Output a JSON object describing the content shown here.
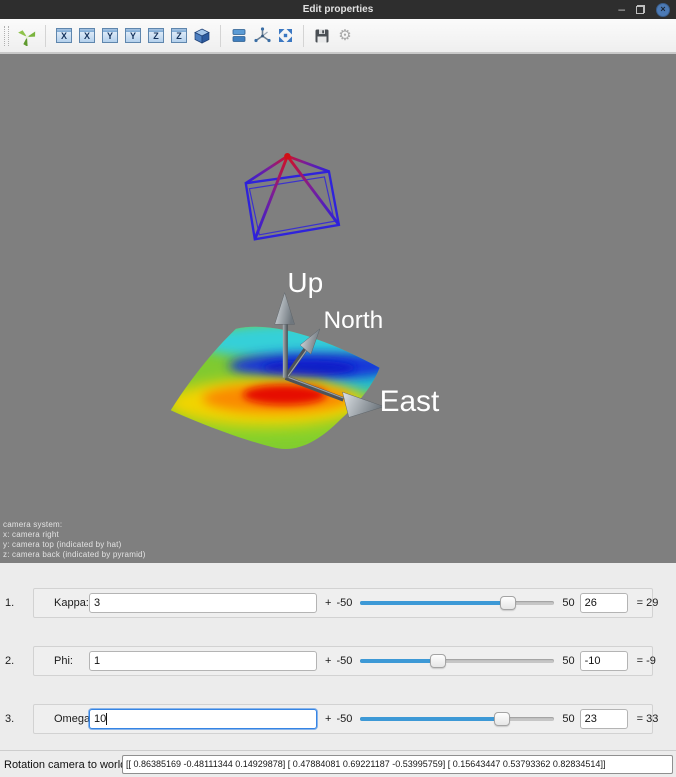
{
  "window": {
    "title": "Edit properties",
    "minimize_glyph": "–",
    "close_glyph": "×"
  },
  "toolbar": {
    "view_buttons": [
      {
        "label": "X"
      },
      {
        "label": "X"
      },
      {
        "label": "Y"
      },
      {
        "label": "Y"
      },
      {
        "label": "Z"
      },
      {
        "label": "Z"
      }
    ],
    "gear_glyph": "⚙",
    "icon_names": [
      "axes-triad-icon",
      "view-x-icon",
      "view-x2-icon",
      "view-y-icon",
      "view-y2-icon",
      "view-z-icon",
      "view-z2-icon",
      "cube-icon",
      "layers-icon",
      "origin-axes-icon",
      "fit-view-icon",
      "save-icon",
      "gear-icon"
    ]
  },
  "viewport": {
    "axis_labels": {
      "up": "Up",
      "north": "North",
      "east": "East"
    },
    "camera_info": [
      "camera system:",
      "x: camera right",
      "y: camera top (indicated by hat)",
      "z: camera back (indicated by pyramid)"
    ]
  },
  "controls": {
    "rows": [
      {
        "index": "1.",
        "label": "Kappa:",
        "offset_value": "3",
        "plus_sign": "+",
        "range_min": "-50",
        "range_max": "50",
        "slider_percent": 76,
        "slider_value": "26",
        "result": "= 29"
      },
      {
        "index": "2.",
        "label": "Phi:",
        "offset_value": "1",
        "plus_sign": "+",
        "range_min": "-50",
        "range_max": "50",
        "slider_percent": 40,
        "slider_value": "-10",
        "result": "= -9"
      },
      {
        "index": "3.",
        "label": "Omega:",
        "offset_value": "10",
        "plus_sign": "+",
        "range_min": "-50",
        "range_max": "50",
        "slider_percent": 73,
        "slider_value": "23",
        "result": "= 33"
      }
    ]
  },
  "statusbar": {
    "label": "Rotation camera to world:",
    "matrix": "[[ 0.86385169 -0.48111344  0.14929878] [ 0.47884081  0.69221187 -0.53995759] [ 0.15643447  0.53793362  0.82834514]]"
  },
  "colors": {
    "accent": "#3d99d6",
    "viewport_bg": "#7f7f7f",
    "titlebar_bg": "#2e2e2e",
    "close_button": "#4c7ab5"
  }
}
